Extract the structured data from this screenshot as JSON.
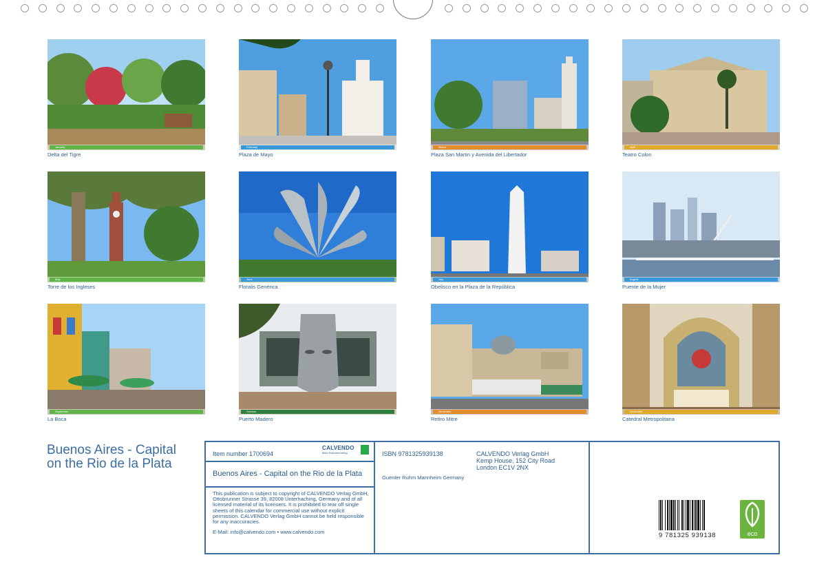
{
  "photos": [
    {
      "caption": "Delta del Tigre",
      "month": "January",
      "strip": "#5fb548",
      "scene": "tigre"
    },
    {
      "caption": "Plaza de Mayo",
      "month": "February",
      "strip": "#3a9ad9",
      "scene": "mayo"
    },
    {
      "caption": "Plaza San Martin y Avenida del Libertador",
      "month": "March",
      "strip": "#e58b2b",
      "scene": "sanmartin"
    },
    {
      "caption": "Teatro Colon",
      "month": "April",
      "strip": "#e0a92a",
      "scene": "colon"
    },
    {
      "caption": "Torre de los Ingleses",
      "month": "May",
      "strip": "#5fb548",
      "scene": "torre"
    },
    {
      "caption": "Floralis Genérica",
      "month": "June",
      "strip": "#3a9ad9",
      "scene": "floralis"
    },
    {
      "caption": "Obelisco en la Plaza de la República",
      "month": "July",
      "strip": "#3a9ad9",
      "scene": "obelisco"
    },
    {
      "caption": "Puente de la Mujer",
      "month": "August",
      "strip": "#3a9ad9",
      "scene": "puente"
    },
    {
      "caption": "La Boca",
      "month": "September",
      "strip": "#5fb548",
      "scene": "boca"
    },
    {
      "caption": "Puerto Madero",
      "month": "October",
      "strip": "#2f7f3f",
      "scene": "madero"
    },
    {
      "caption": "Retiro Mitre",
      "month": "November",
      "strip": "#e58b2b",
      "scene": "retiro"
    },
    {
      "caption": "Catedral Metropolitana",
      "month": "December",
      "strip": "#e0a92a",
      "scene": "catedral"
    }
  ],
  "title": "Buenos Aires - Capital on the Rio de la Plata",
  "info": {
    "item_number": "Item number 1700694",
    "brand": "CALVENDO",
    "brand_tagline": "Mein Kalenderverlag",
    "product_title": "Buenos Aires - Capital on the Rio de la Plata",
    "copyright": "This publication is subject to copyright of CALVENDO Verlag GmbH, Ottobrunner Strasse 39, 82008 Unterhaching, Germany and of all licensed material of its licensers. It is prohibited to tear off single sheets of this calendar for commercial use without explicit permission. CALVENDO Verlag GmbH cannot be held responsible for any inaccuracies.",
    "email": "E-Mail: info@calvendo.com • www.calvendo.com",
    "isbn": "ISBN 9781325939138",
    "publisher_line1": "CALVENDO Verlag GmbH",
    "publisher_line2": "Kemp House, 152 City Road",
    "publisher_line3": "London EC1V 2NX",
    "author": "Guenter Ruhm Mannheim Germany",
    "barcode_number": "9 781325 939138",
    "eco_label": "eco"
  },
  "colors": {
    "accent": "#3a6ea5",
    "text": "#2a5d8f"
  }
}
